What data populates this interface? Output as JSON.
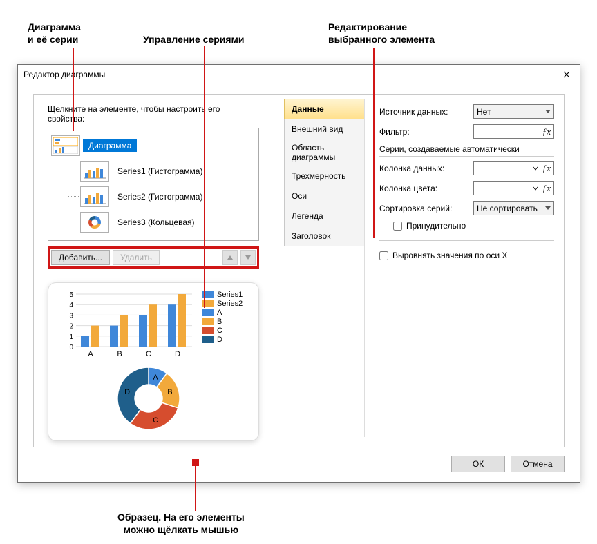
{
  "annotations": {
    "diagram_series": "Диаграмма\nи её серии",
    "series_mgmt": "Управление сериями",
    "edit_selected": "Редактирование\nвыбранного элемента",
    "preview_note": "Образец. На его элементы\nможно щёлкать мышью"
  },
  "dialog": {
    "title": "Редактор диаграммы",
    "instruction": "Щелкните на элементе, чтобы настроить его свойства:",
    "tree": {
      "root": "Диаграмма",
      "items": [
        "Series1 (Гистограмма)",
        "Series2 (Гистограмма)",
        "Series3 (Кольцевая)"
      ]
    },
    "add_btn": "Добавить...",
    "delete_btn": "Удалить",
    "tabs": [
      "Данные",
      "Внешний вид",
      "Область диаграммы",
      "Трехмерность",
      "Оси",
      "Легенда",
      "Заголовок"
    ],
    "form": {
      "source_label": "Источник данных:",
      "source_value": "Нет",
      "filter_label": "Фильтр:",
      "group_title": "Серии, создаваемые автоматически",
      "data_col_label": "Колонка данных:",
      "color_col_label": "Колонка цвета:",
      "sort_label": "Сортировка серий:",
      "sort_value": "Не сортировать",
      "force_check": "Принудительно",
      "align_x_check": "Выровнять значения по оси X"
    },
    "ok": "ОК",
    "cancel": "Отмена"
  },
  "preview": {
    "legend": [
      "Series1",
      "Series2",
      "A",
      "B",
      "C",
      "D"
    ],
    "y_ticks": [
      "5",
      "4",
      "3",
      "2",
      "1",
      "0"
    ],
    "x_cats": [
      "A",
      "B",
      "C",
      "D"
    ],
    "donut_labels": [
      "A",
      "B",
      "C",
      "D"
    ]
  },
  "chart_data": [
    {
      "type": "bar",
      "categories": [
        "A",
        "B",
        "C",
        "D"
      ],
      "series": [
        {
          "name": "Series1",
          "values": [
            1,
            2,
            3,
            4
          ],
          "color": "#3f87d9"
        },
        {
          "name": "Series2",
          "values": [
            2,
            3,
            4,
            5
          ],
          "color": "#f2a93b"
        }
      ],
      "ylim": [
        0,
        5
      ],
      "legend_extra": [
        "A",
        "B",
        "C",
        "D"
      ]
    },
    {
      "type": "pie",
      "variant": "donut",
      "slices": [
        {
          "label": "A",
          "value": 1,
          "color": "#3f87d9"
        },
        {
          "label": "B",
          "value": 2,
          "color": "#f2a93b"
        },
        {
          "label": "C",
          "value": 3,
          "color": "#d64d2e"
        },
        {
          "label": "D",
          "value": 4,
          "color": "#1f5f8b"
        }
      ]
    }
  ]
}
